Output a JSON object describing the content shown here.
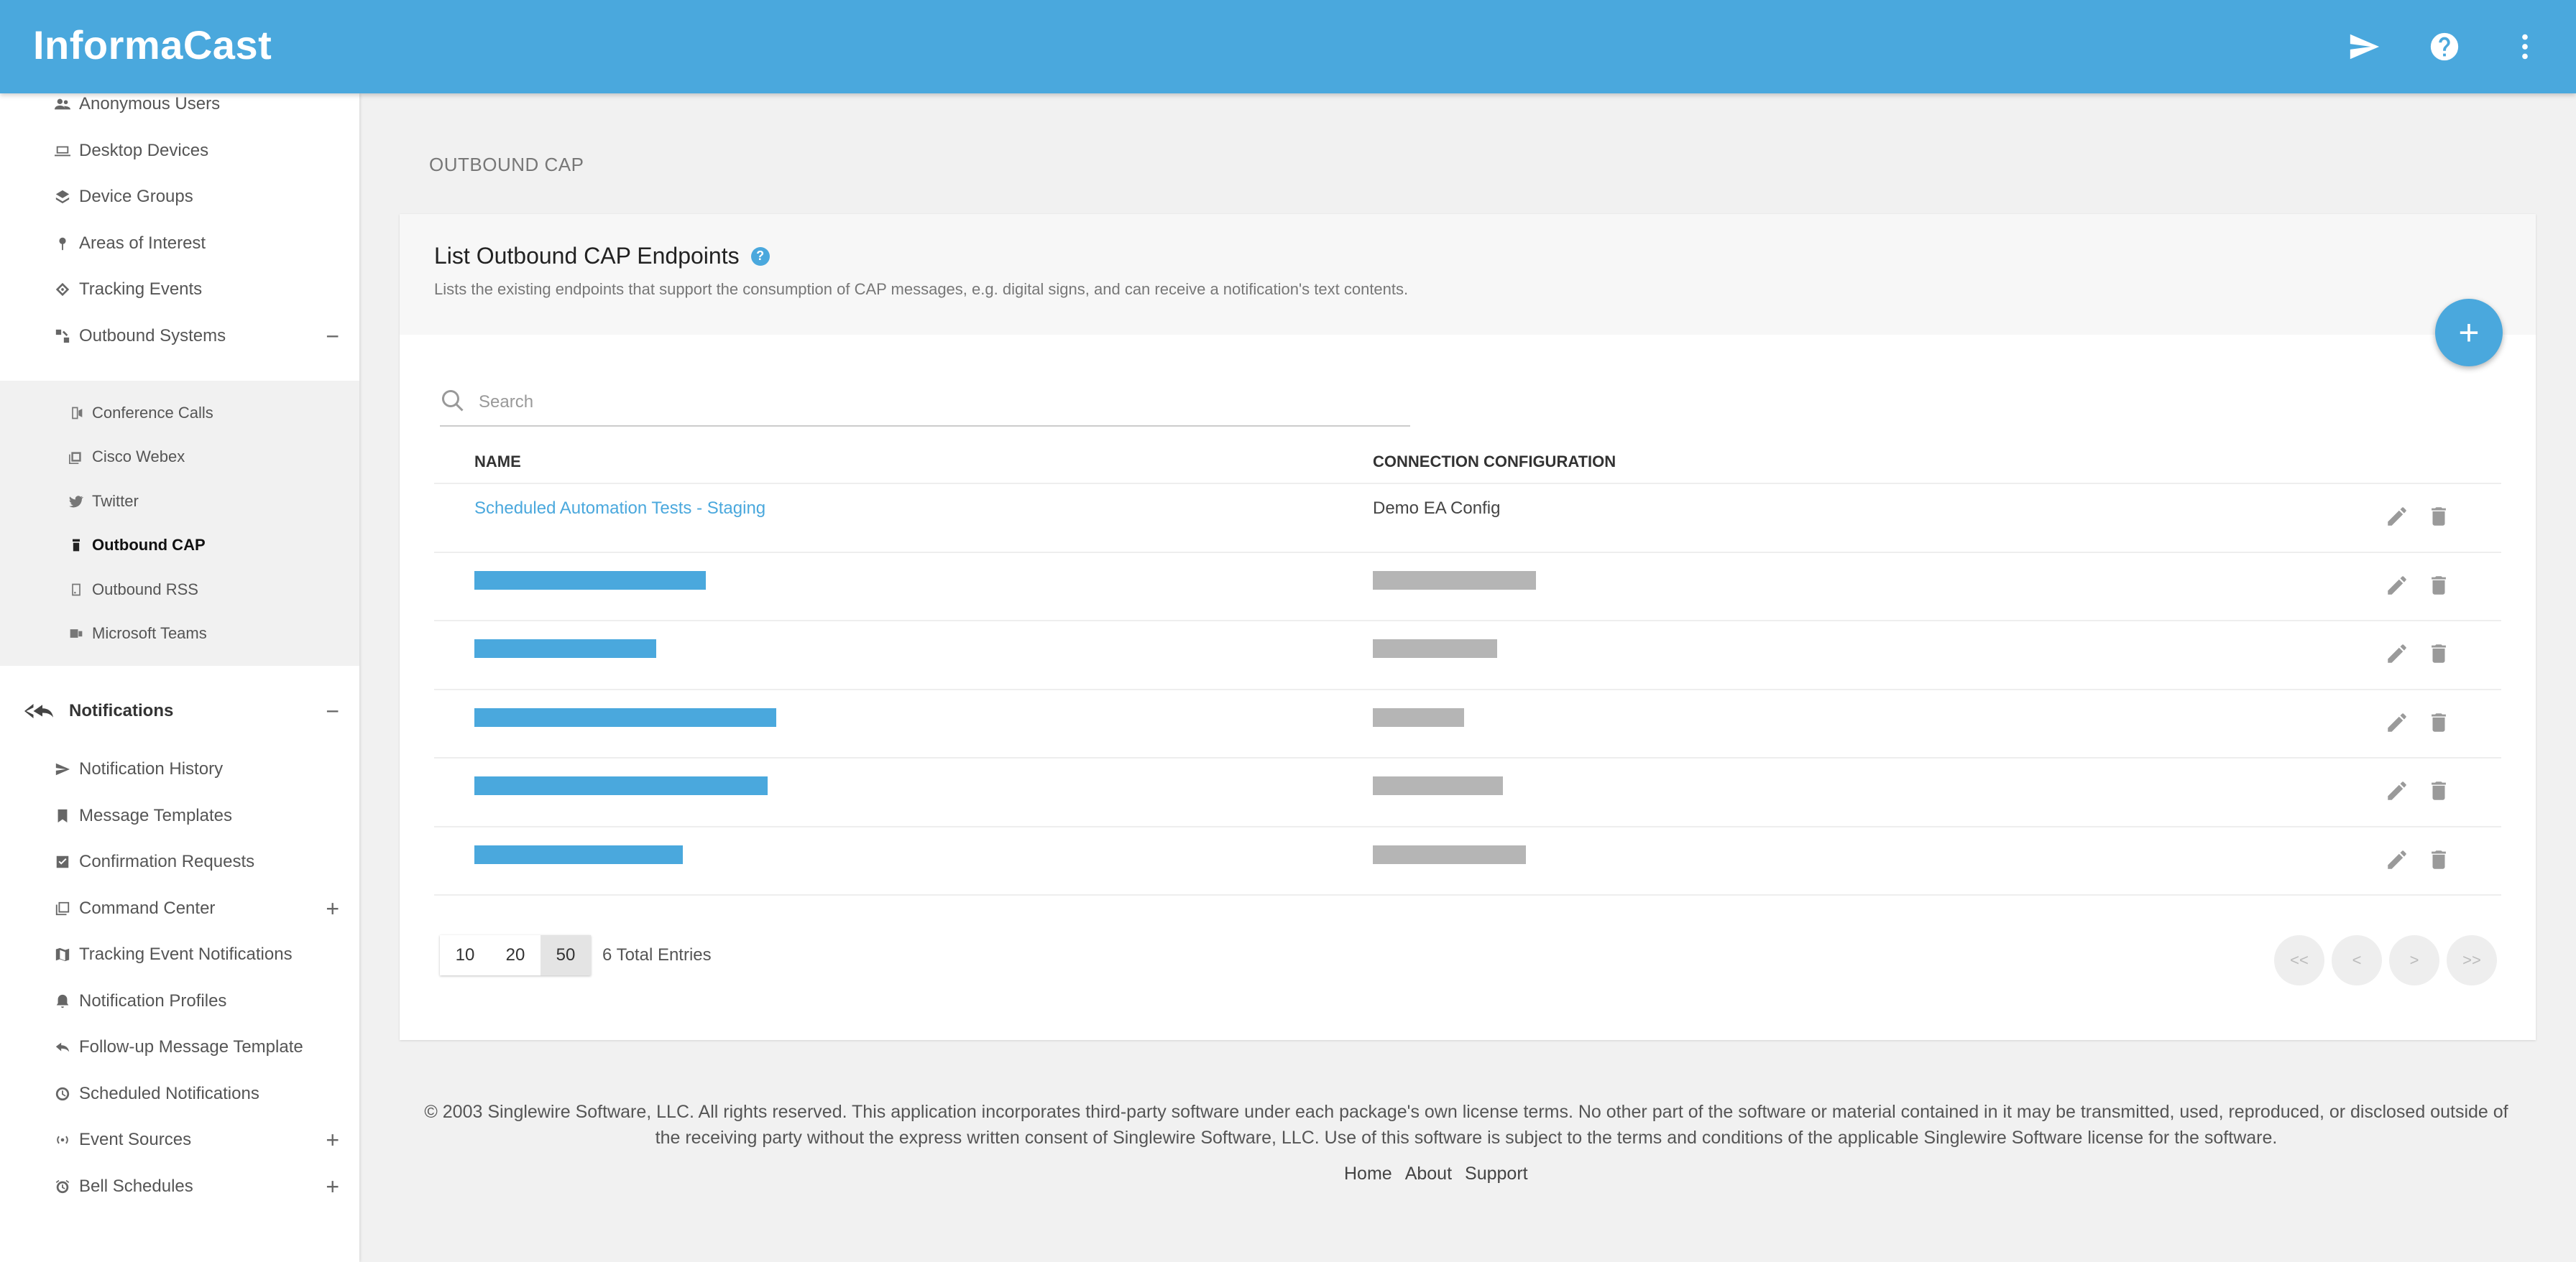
{
  "app": {
    "title": "InformaCast"
  },
  "header_icons": [
    "send-icon",
    "help-icon",
    "more-vert-icon"
  ],
  "colors": {
    "brand": "#4aa8dd",
    "sidebar_bg": "#ffffff",
    "page_bg": "#f1f1f1"
  },
  "sidebar": {
    "top_items": [
      {
        "label": "Anonymous Users",
        "icon": "users-icon"
      },
      {
        "label": "Desktop Devices",
        "icon": "laptop-icon"
      },
      {
        "label": "Device Groups",
        "icon": "layers-icon"
      },
      {
        "label": "Areas of Interest",
        "icon": "pin-icon"
      },
      {
        "label": "Tracking Events",
        "icon": "target-icon"
      },
      {
        "label": "Outbound Systems",
        "icon": "outbound-icon",
        "toggle": "−"
      }
    ],
    "outbound_sub": [
      {
        "label": "Conference Calls",
        "icon": "phone-icon"
      },
      {
        "label": "Cisco Webex",
        "icon": "webex-icon"
      },
      {
        "label": "Twitter",
        "icon": "twitter-icon"
      },
      {
        "label": "Outbound CAP",
        "icon": "cap-icon"
      },
      {
        "label": "Outbound RSS",
        "icon": "rss-icon"
      },
      {
        "label": "Microsoft Teams",
        "icon": "teams-icon"
      }
    ],
    "notifications": {
      "label": "Notifications",
      "toggle": "−",
      "items": [
        {
          "label": "Notification History",
          "icon": "send-icon"
        },
        {
          "label": "Message Templates",
          "icon": "bookmark-icon"
        },
        {
          "label": "Confirmation Requests",
          "icon": "check-icon"
        },
        {
          "label": "Command Center",
          "icon": "command-icon",
          "toggle": "+"
        },
        {
          "label": "Tracking Event Notifications",
          "icon": "map-icon"
        },
        {
          "label": "Notification Profiles",
          "icon": "bell-icon"
        },
        {
          "label": "Follow-up Message Template",
          "icon": "reply-icon"
        },
        {
          "label": "Scheduled Notifications",
          "icon": "clock-icon"
        },
        {
          "label": "Event Sources",
          "icon": "broadcast-icon",
          "toggle": "+"
        },
        {
          "label": "Bell Schedules",
          "icon": "alarm-icon",
          "toggle": "+"
        }
      ]
    }
  },
  "page": {
    "title": "OUTBOUND CAP",
    "card_title": "List Outbound CAP Endpoints",
    "card_description": "Lists the existing endpoints that support the consumption of CAP messages, e.g. digital signs, and can receive a notification's text contents.",
    "add_button": "+"
  },
  "search": {
    "placeholder": "Search",
    "value": ""
  },
  "table": {
    "headers": [
      "NAME",
      "CONNECTION CONFIGURATION"
    ],
    "rows": [
      {
        "name": "Scheduled Automation Tests - Staging",
        "configuration": "Demo EA Config",
        "redacted": false
      },
      {
        "redacted": true,
        "name_bar_fraction": 0.112,
        "conf_bar_fraction": 0.079
      },
      {
        "redacted": true,
        "name_bar_fraction": 0.088,
        "conf_bar_fraction": 0.06
      },
      {
        "redacted": true,
        "name_bar_fraction": 0.146,
        "conf_bar_fraction": 0.044
      },
      {
        "redacted": true,
        "name_bar_fraction": 0.142,
        "conf_bar_fraction": 0.063
      },
      {
        "redacted": true,
        "name_bar_fraction": 0.101,
        "conf_bar_fraction": 0.074
      }
    ]
  },
  "pagination": {
    "page_sizes": [
      "10",
      "20",
      "50"
    ],
    "selected_size": "50",
    "total": "6 Total Entries",
    "nav": [
      "<<",
      "<",
      ">",
      ">>"
    ]
  },
  "footer": {
    "copyright": "© 2003 Singlewire Software, LLC. All rights reserved. This application incorporates third-party software under each package's own license terms. No other part of the software or material contained in it may be transmitted, used, reproduced, or disclosed outside of the receiving party without the express written consent of Singlewire Software, LLC. Use of this software is subject to the terms and conditions of the applicable Singlewire Software license for the software.",
    "links": [
      "Home",
      "About",
      "Support"
    ]
  }
}
